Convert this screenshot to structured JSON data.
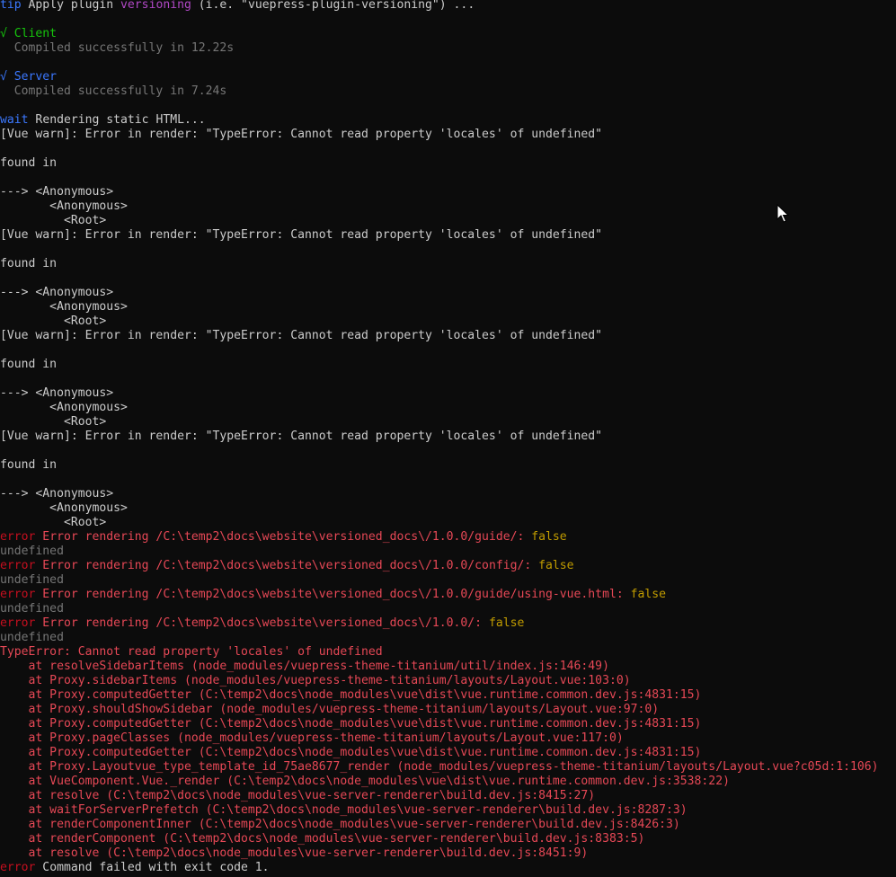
{
  "terminal": {
    "lines": [
      [
        {
          "t": "tip",
          "c": "blue"
        },
        {
          "t": " Apply plugin ",
          "c": "white"
        },
        {
          "t": "versioning",
          "c": "magenta"
        },
        {
          "t": " (i.e. \"vuepress-plugin-versioning\") ...",
          "c": "white"
        }
      ],
      [],
      [
        {
          "t": "√ Client",
          "c": "green"
        }
      ],
      [
        {
          "t": "  Compiled successfully in 12.22s",
          "c": "gray"
        }
      ],
      [],
      [
        {
          "t": "√ Server",
          "c": "blue"
        }
      ],
      [
        {
          "t": "  Compiled successfully in 7.24s",
          "c": "gray"
        }
      ],
      [],
      [
        {
          "t": "wait",
          "c": "blue"
        },
        {
          "t": " Rendering static HTML...",
          "c": "white"
        }
      ],
      [
        {
          "t": "[Vue warn]: Error in render: \"TypeError: Cannot read property 'locales' of undefined\"",
          "c": "white"
        }
      ],
      [],
      [
        {
          "t": "found in",
          "c": "white"
        }
      ],
      [],
      [
        {
          "t": "---> <Anonymous>",
          "c": "white"
        }
      ],
      [
        {
          "t": "       <Anonymous>",
          "c": "white"
        }
      ],
      [
        {
          "t": "         <Root>",
          "c": "white"
        }
      ],
      [
        {
          "t": "[Vue warn]: Error in render: \"TypeError: Cannot read property 'locales' of undefined\"",
          "c": "white"
        }
      ],
      [],
      [
        {
          "t": "found in",
          "c": "white"
        }
      ],
      [],
      [
        {
          "t": "---> <Anonymous>",
          "c": "white"
        }
      ],
      [
        {
          "t": "       <Anonymous>",
          "c": "white"
        }
      ],
      [
        {
          "t": "         <Root>",
          "c": "white"
        }
      ],
      [
        {
          "t": "[Vue warn]: Error in render: \"TypeError: Cannot read property 'locales' of undefined\"",
          "c": "white"
        }
      ],
      [],
      [
        {
          "t": "found in",
          "c": "white"
        }
      ],
      [],
      [
        {
          "t": "---> <Anonymous>",
          "c": "white"
        }
      ],
      [
        {
          "t": "       <Anonymous>",
          "c": "white"
        }
      ],
      [
        {
          "t": "         <Root>",
          "c": "white"
        }
      ],
      [
        {
          "t": "[Vue warn]: Error in render: \"TypeError: Cannot read property 'locales' of undefined\"",
          "c": "white"
        }
      ],
      [],
      [
        {
          "t": "found in",
          "c": "white"
        }
      ],
      [],
      [
        {
          "t": "---> <Anonymous>",
          "c": "white"
        }
      ],
      [
        {
          "t": "       <Anonymous>",
          "c": "white"
        }
      ],
      [
        {
          "t": "         <Root>",
          "c": "white"
        }
      ],
      [
        {
          "t": "error",
          "c": "red-dark"
        },
        {
          "t": " Error rendering /C:\\temp2\\docs\\website\\versioned_docs\\/1.0.0/guide/: ",
          "c": "red"
        },
        {
          "t": "false",
          "c": "yellow"
        }
      ],
      [
        {
          "t": "undefined",
          "c": "gray"
        }
      ],
      [
        {
          "t": "error",
          "c": "red-dark"
        },
        {
          "t": " Error rendering /C:\\temp2\\docs\\website\\versioned_docs\\/1.0.0/config/: ",
          "c": "red"
        },
        {
          "t": "false",
          "c": "yellow"
        }
      ],
      [
        {
          "t": "undefined",
          "c": "gray"
        }
      ],
      [
        {
          "t": "error",
          "c": "red-dark"
        },
        {
          "t": " Error rendering /C:\\temp2\\docs\\website\\versioned_docs\\/1.0.0/guide/using-vue.html: ",
          "c": "red"
        },
        {
          "t": "false",
          "c": "yellow"
        }
      ],
      [
        {
          "t": "undefined",
          "c": "gray"
        }
      ],
      [
        {
          "t": "error",
          "c": "red-dark"
        },
        {
          "t": " Error rendering /C:\\temp2\\docs\\website\\versioned_docs\\/1.0.0/: ",
          "c": "red"
        },
        {
          "t": "false",
          "c": "yellow"
        }
      ],
      [
        {
          "t": "undefined",
          "c": "gray"
        }
      ],
      [
        {
          "t": "TypeError: Cannot read property 'locales' of undefined",
          "c": "red"
        }
      ],
      [
        {
          "t": "    at resolveSidebarItems (node_modules/vuepress-theme-titanium/util/index.js:146:49)",
          "c": "red"
        }
      ],
      [
        {
          "t": "    at Proxy.sidebarItems (node_modules/vuepress-theme-titanium/layouts/Layout.vue:103:0)",
          "c": "red"
        }
      ],
      [
        {
          "t": "    at Proxy.computedGetter (C:\\temp2\\docs\\node_modules\\vue\\dist\\vue.runtime.common.dev.js:4831:15)",
          "c": "red"
        }
      ],
      [
        {
          "t": "    at Proxy.shouldShowSidebar (node_modules/vuepress-theme-titanium/layouts/Layout.vue:97:0)",
          "c": "red"
        }
      ],
      [
        {
          "t": "    at Proxy.computedGetter (C:\\temp2\\docs\\node_modules\\vue\\dist\\vue.runtime.common.dev.js:4831:15)",
          "c": "red"
        }
      ],
      [
        {
          "t": "    at Proxy.pageClasses (node_modules/vuepress-theme-titanium/layouts/Layout.vue:117:0)",
          "c": "red"
        }
      ],
      [
        {
          "t": "    at Proxy.computedGetter (C:\\temp2\\docs\\node_modules\\vue\\dist\\vue.runtime.common.dev.js:4831:15)",
          "c": "red"
        }
      ],
      [
        {
          "t": "    at Proxy.Layoutvue_type_template_id_75ae8677_render (node_modules/vuepress-theme-titanium/layouts/Layout.vue?c05d:1:106)",
          "c": "red"
        }
      ],
      [
        {
          "t": "    at VueComponent.Vue._render (C:\\temp2\\docs\\node_modules\\vue\\dist\\vue.runtime.common.dev.js:3538:22)",
          "c": "red"
        }
      ],
      [
        {
          "t": "    at resolve (C:\\temp2\\docs\\node_modules\\vue-server-renderer\\build.dev.js:8415:27)",
          "c": "red"
        }
      ],
      [
        {
          "t": "    at waitForServerPrefetch (C:\\temp2\\docs\\node_modules\\vue-server-renderer\\build.dev.js:8287:3)",
          "c": "red"
        }
      ],
      [
        {
          "t": "    at renderComponentInner (C:\\temp2\\docs\\node_modules\\vue-server-renderer\\build.dev.js:8426:3)",
          "c": "red"
        }
      ],
      [
        {
          "t": "    at renderComponent (C:\\temp2\\docs\\node_modules\\vue-server-renderer\\build.dev.js:8383:5)",
          "c": "red"
        }
      ],
      [
        {
          "t": "    at resolve (C:\\temp2\\docs\\node_modules\\vue-server-renderer\\build.dev.js:8451:9)",
          "c": "red"
        }
      ],
      [
        {
          "t": "error",
          "c": "red-dark"
        },
        {
          "t": " Command failed with exit code 1.",
          "c": "white"
        }
      ]
    ]
  },
  "cursor": {
    "icon": "mouse-pointer-icon"
  },
  "colors": {
    "background": "#0c0c0c",
    "foreground": "#cccccc",
    "blue": "#3b78ff",
    "magenta": "#b148c6",
    "green": "#16c60c",
    "gray": "#767676",
    "red": "#e74856",
    "red_dark": "#c50f1f",
    "yellow": "#c19c00"
  }
}
